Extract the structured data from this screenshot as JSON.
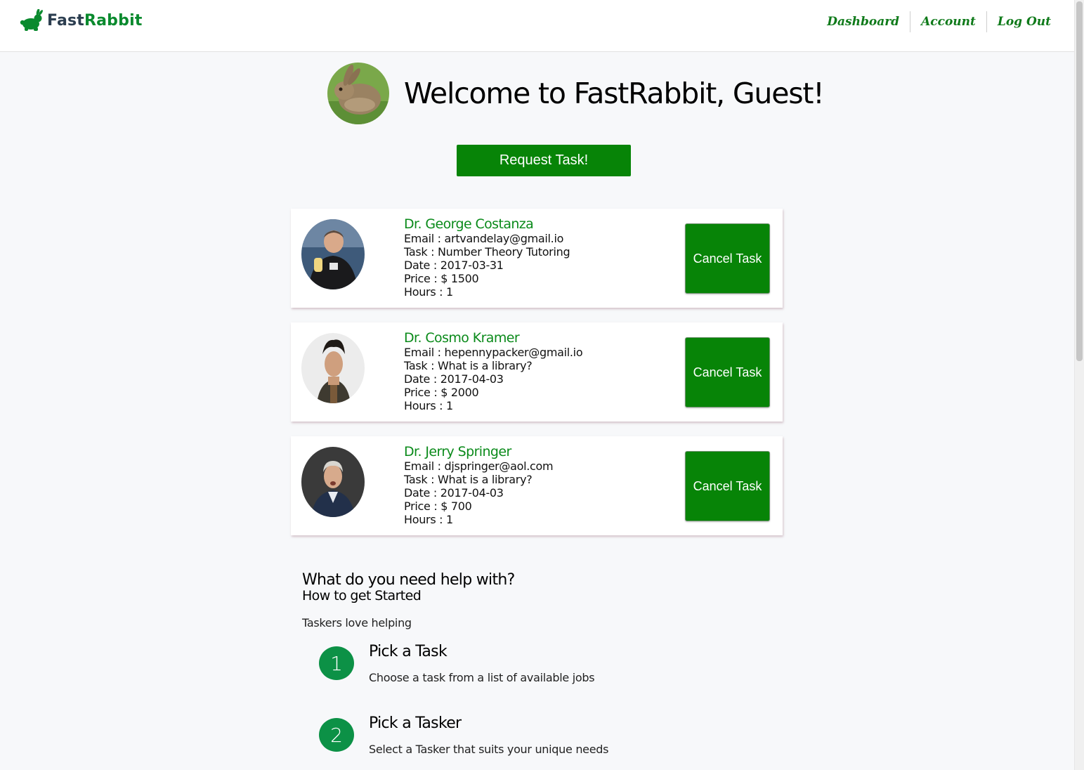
{
  "brand": {
    "name_part1": "Fast",
    "name_part2": "Rabbit",
    "accent": "#0a8a2e"
  },
  "nav": {
    "items": [
      "Dashboard",
      "Account",
      "Log Out"
    ]
  },
  "welcome": {
    "title": "Welcome to FastRabbit, Guest!"
  },
  "request_button": {
    "label": "Request Task!"
  },
  "tasks": [
    {
      "name": "Dr. George Costanza",
      "email": "Email : artvandelay@gmail.io",
      "task": "Task : Number Theory Tutoring",
      "date": "Date : 2017-03-31",
      "price": "Price : $ 1500",
      "hours": "Hours : 1",
      "button": "Cancel Task"
    },
    {
      "name": "Dr. Cosmo Kramer",
      "email": "Email : hepennypacker@gmail.io",
      "task": "Task : What is a library?",
      "date": "Date : 2017-04-03",
      "price": "Price : $ 2000",
      "hours": "Hours : 1",
      "button": "Cancel Task"
    },
    {
      "name": "Dr. Jerry Springer",
      "email": "Email : djspringer@aol.com",
      "task": "Task : What is a library?",
      "date": "Date : 2017-04-03",
      "price": "Price : $ 700",
      "hours": "Hours : 1",
      "button": "Cancel Task"
    }
  ],
  "help": {
    "heading": "What do you need help with?",
    "subheading": "How to get Started",
    "tagline": "Taskers love helping",
    "steps": [
      {
        "number": "1",
        "title": "Pick a Task",
        "desc": "Choose a task from a list of available jobs"
      },
      {
        "number": "2",
        "title": "Pick a Tasker",
        "desc": "Select a Tasker that suits your unique needs"
      }
    ]
  }
}
